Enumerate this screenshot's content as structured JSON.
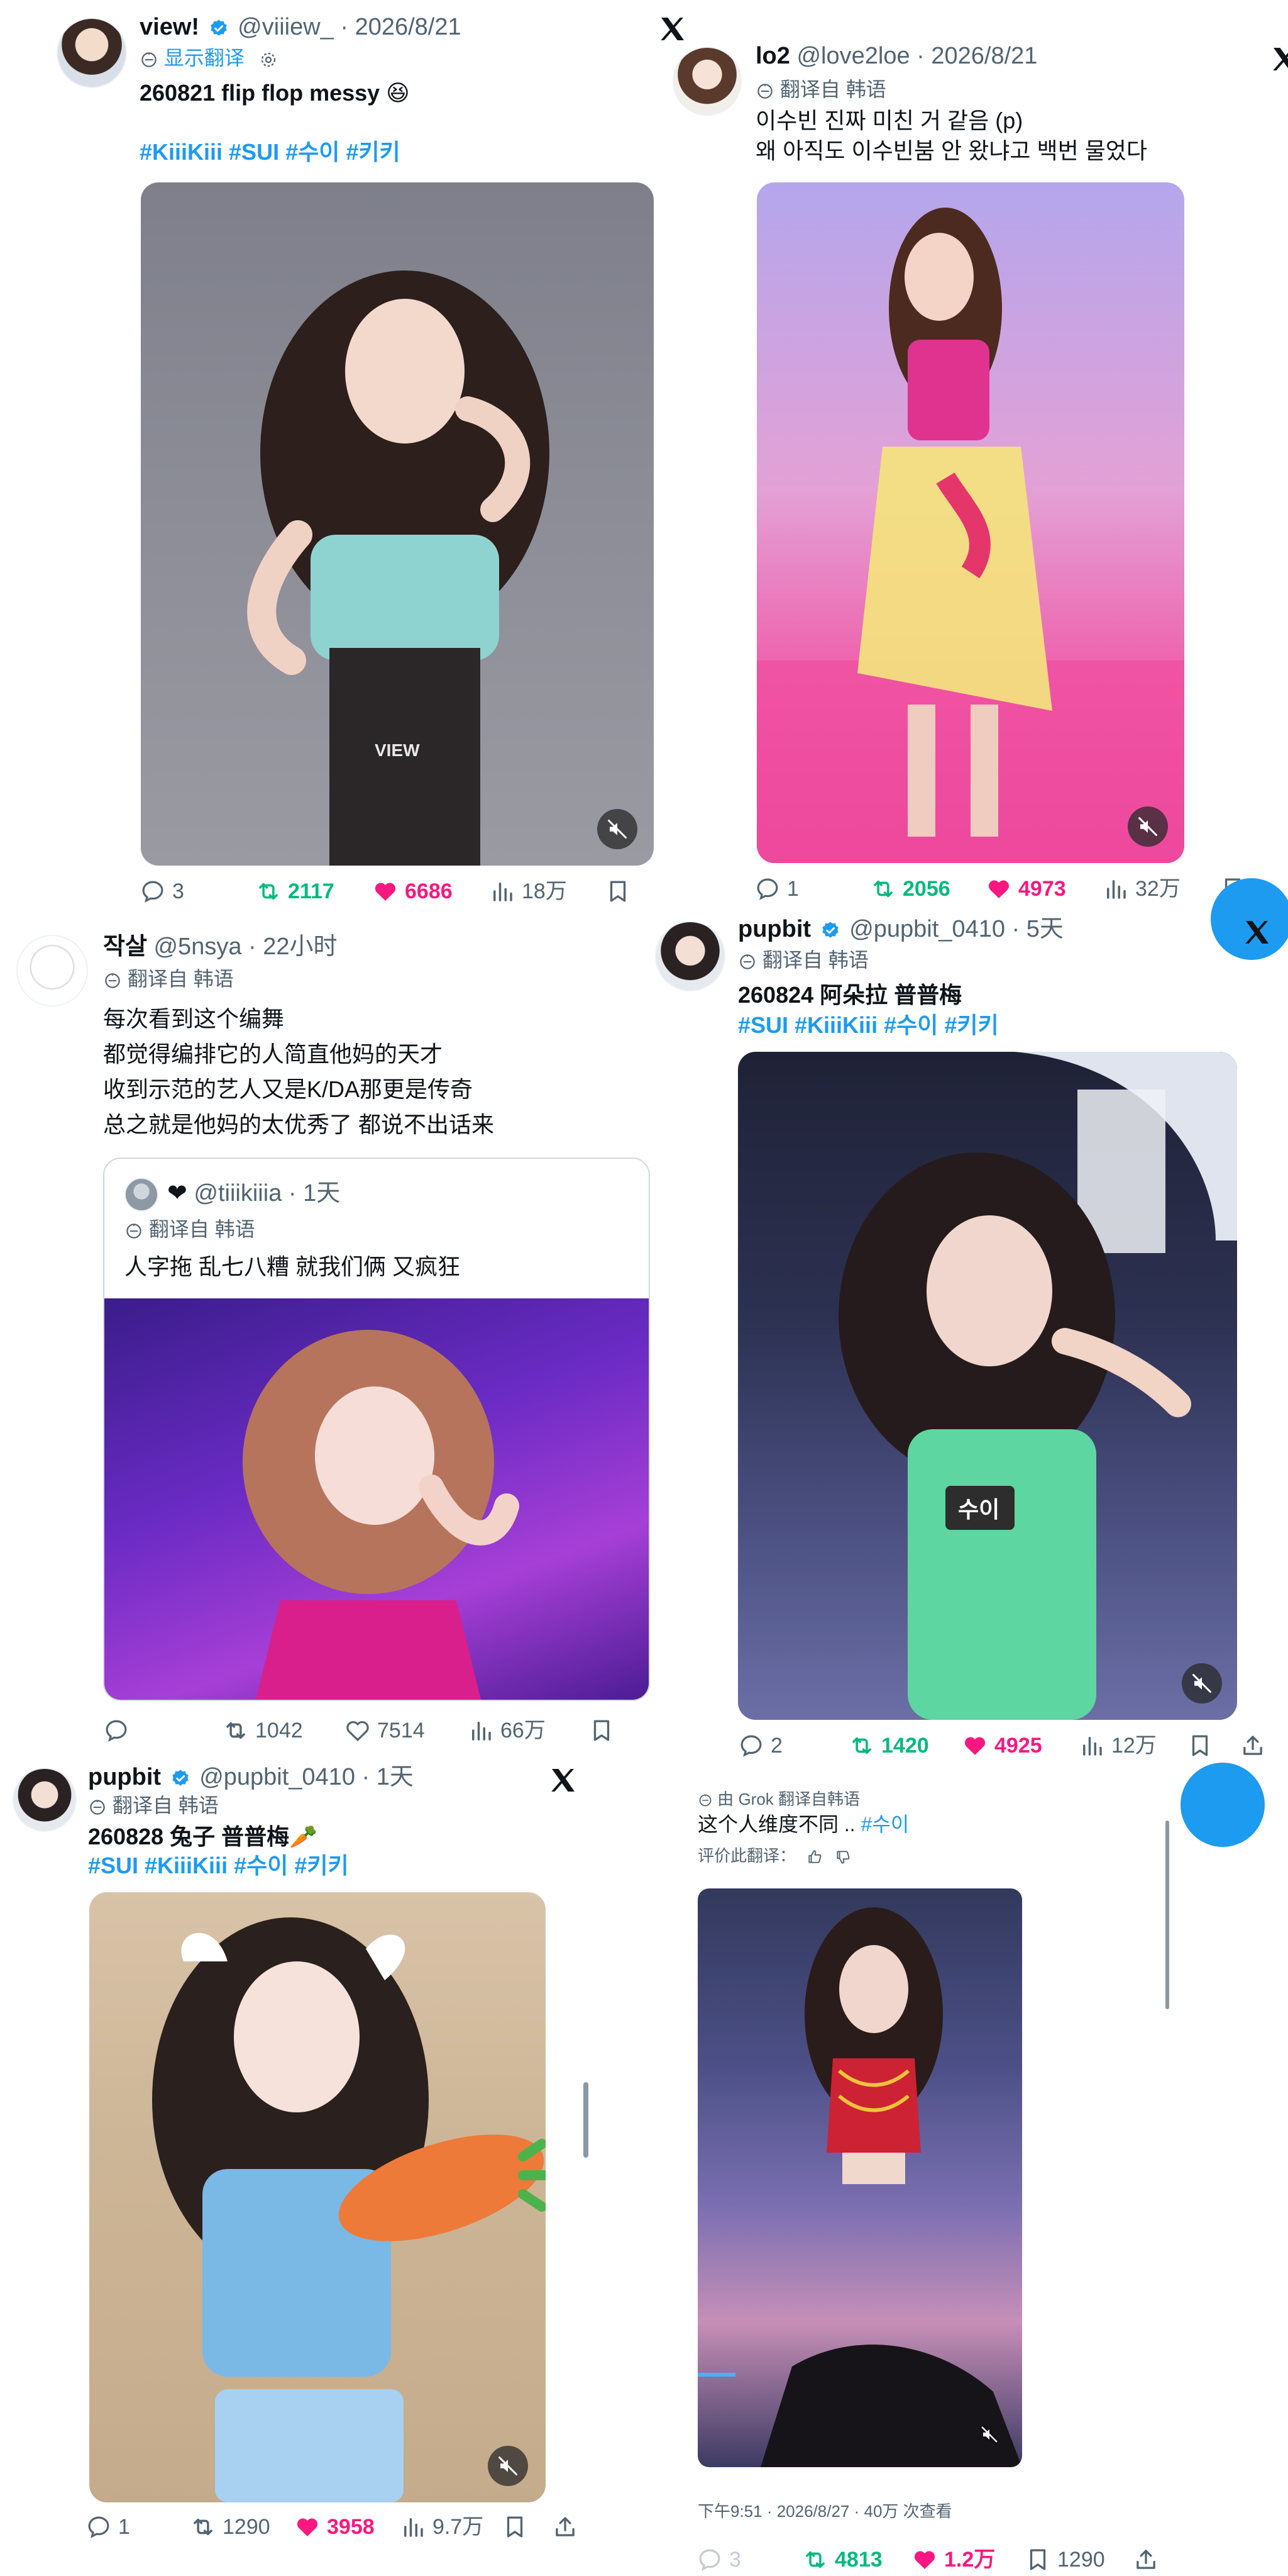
{
  "tweets": [
    {
      "name": "view!",
      "handle": "@viiiew_",
      "date": "2026/8/21",
      "translate": "显示翻译",
      "text": "260821 flip flop messy 😆",
      "hashtags": "#KiiiKiii #SUI #수이 #키키",
      "replies": "3",
      "retweets": "2117",
      "likes": "6686",
      "views": "18万",
      "watermark": "VIEW"
    },
    {
      "name": "lo2",
      "handle": "@love2loe",
      "date": "2026/8/21",
      "translate": "翻译自 韩语",
      "line1": "이수빈 진짜 미친 거 같음 (p)",
      "line2": "왜 아직도 이수빈붐 안 왔냐고 백번 물었다",
      "replies": "1",
      "retweets": "2056",
      "likes": "4973",
      "views": "32万"
    },
    {
      "name": "작살",
      "handle": "@5nsya",
      "time": "22小时",
      "translate": "翻译自 韩语",
      "lines": [
        "每次看到这个编舞",
        "都觉得编排它的人简直他妈的天才",
        "收到示范的艺人又是K/DA那更是传奇",
        "总之就是他妈的太优秀了 都说不出话来"
      ],
      "quote": {
        "name": "❤",
        "handle": "@tiiikiiia",
        "time": "1天",
        "translate": "翻译自 韩语",
        "text": "人字拖 乱七八糟 就我们俩 又疯狂"
      },
      "replies": "",
      "retweets": "1042",
      "likes": "7514",
      "views": "66万"
    },
    {
      "name": "pupbit",
      "handle": "@pupbit_0410",
      "time": "5天",
      "translate": "翻译自 韩语",
      "text": "260824 阿朵拉 普普梅",
      "hashtags": "#SUI #KiiiKiii #수이 #키키",
      "nametag": "수이",
      "replies": "2",
      "retweets": "1420",
      "likes": "4925",
      "views": "12万"
    },
    {
      "name": "pupbit",
      "handle": "@pupbit_0410",
      "time": "1天",
      "translate": "翻译自 韩语",
      "text": "260828 兔子 普普梅🥕",
      "hashtags": "#SUI #KiiiKiii #수이 #키키",
      "replies": "1",
      "retweets": "1290",
      "likes": "3958",
      "views": "9.7万"
    },
    {
      "translate": "由 Grok 翻译自韩语",
      "text": "这个人维度不同 .. ",
      "hashtag": "#수이",
      "rate": "评价此翻译：",
      "meta": "下午9:51 · 2026/8/27 · 40万 次查看",
      "replies": "3",
      "retweets": "4813",
      "likes": "1.2万",
      "bookmarks": "1290"
    }
  ],
  "colors": {
    "accent": "#1d9bf0",
    "retweet": "#00ba7c",
    "like": "#f91880",
    "secondary": "#536471"
  }
}
